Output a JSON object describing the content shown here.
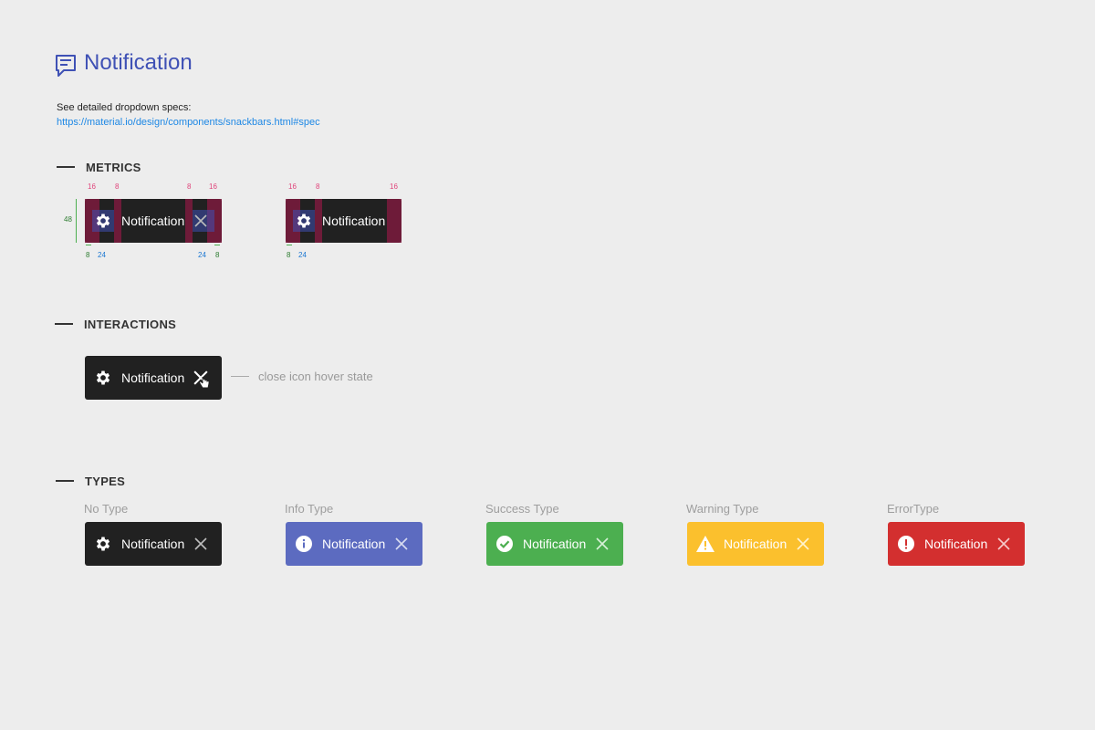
{
  "header": {
    "title": "Notification",
    "title_icon": "feedback-icon",
    "spec_text": "See detailed dropdown specs:",
    "spec_link": "https://material.io/design/components/snackbars.html#spec"
  },
  "sections": {
    "metrics": "METRICS",
    "interactions": "INTERACTIONS",
    "types": "TYPES"
  },
  "metrics": {
    "snack_label": "Notification",
    "top_a": [
      "16",
      "8",
      "8",
      "16"
    ],
    "top_b": [
      "16",
      "8",
      "16"
    ],
    "bottom_a": [
      "8",
      "24",
      "24",
      "8"
    ],
    "bottom_b": [
      "8",
      "24"
    ],
    "height": "48"
  },
  "interactions": {
    "snack_label": "Notification",
    "note": "close icon hover state"
  },
  "types": [
    {
      "label": "No Type",
      "text": "Notification",
      "color": "#212121",
      "icon": "gear-icon"
    },
    {
      "label": "Info Type",
      "text": "Notification",
      "color": "#5c6bc0",
      "icon": "info-icon"
    },
    {
      "label": "Success Type",
      "text": "Notification",
      "color": "#4caf50",
      "icon": "check-circle-icon"
    },
    {
      "label": "Warning Type",
      "text": "Notification",
      "color": "#fbc02d",
      "icon": "warning-icon"
    },
    {
      "label": "ErrorType",
      "text": "Notification",
      "color": "#d32f2f",
      "icon": "error-icon"
    }
  ],
  "colors": {
    "brand": "#3f51b5",
    "link": "#1e88e5",
    "background": "#ededed"
  }
}
